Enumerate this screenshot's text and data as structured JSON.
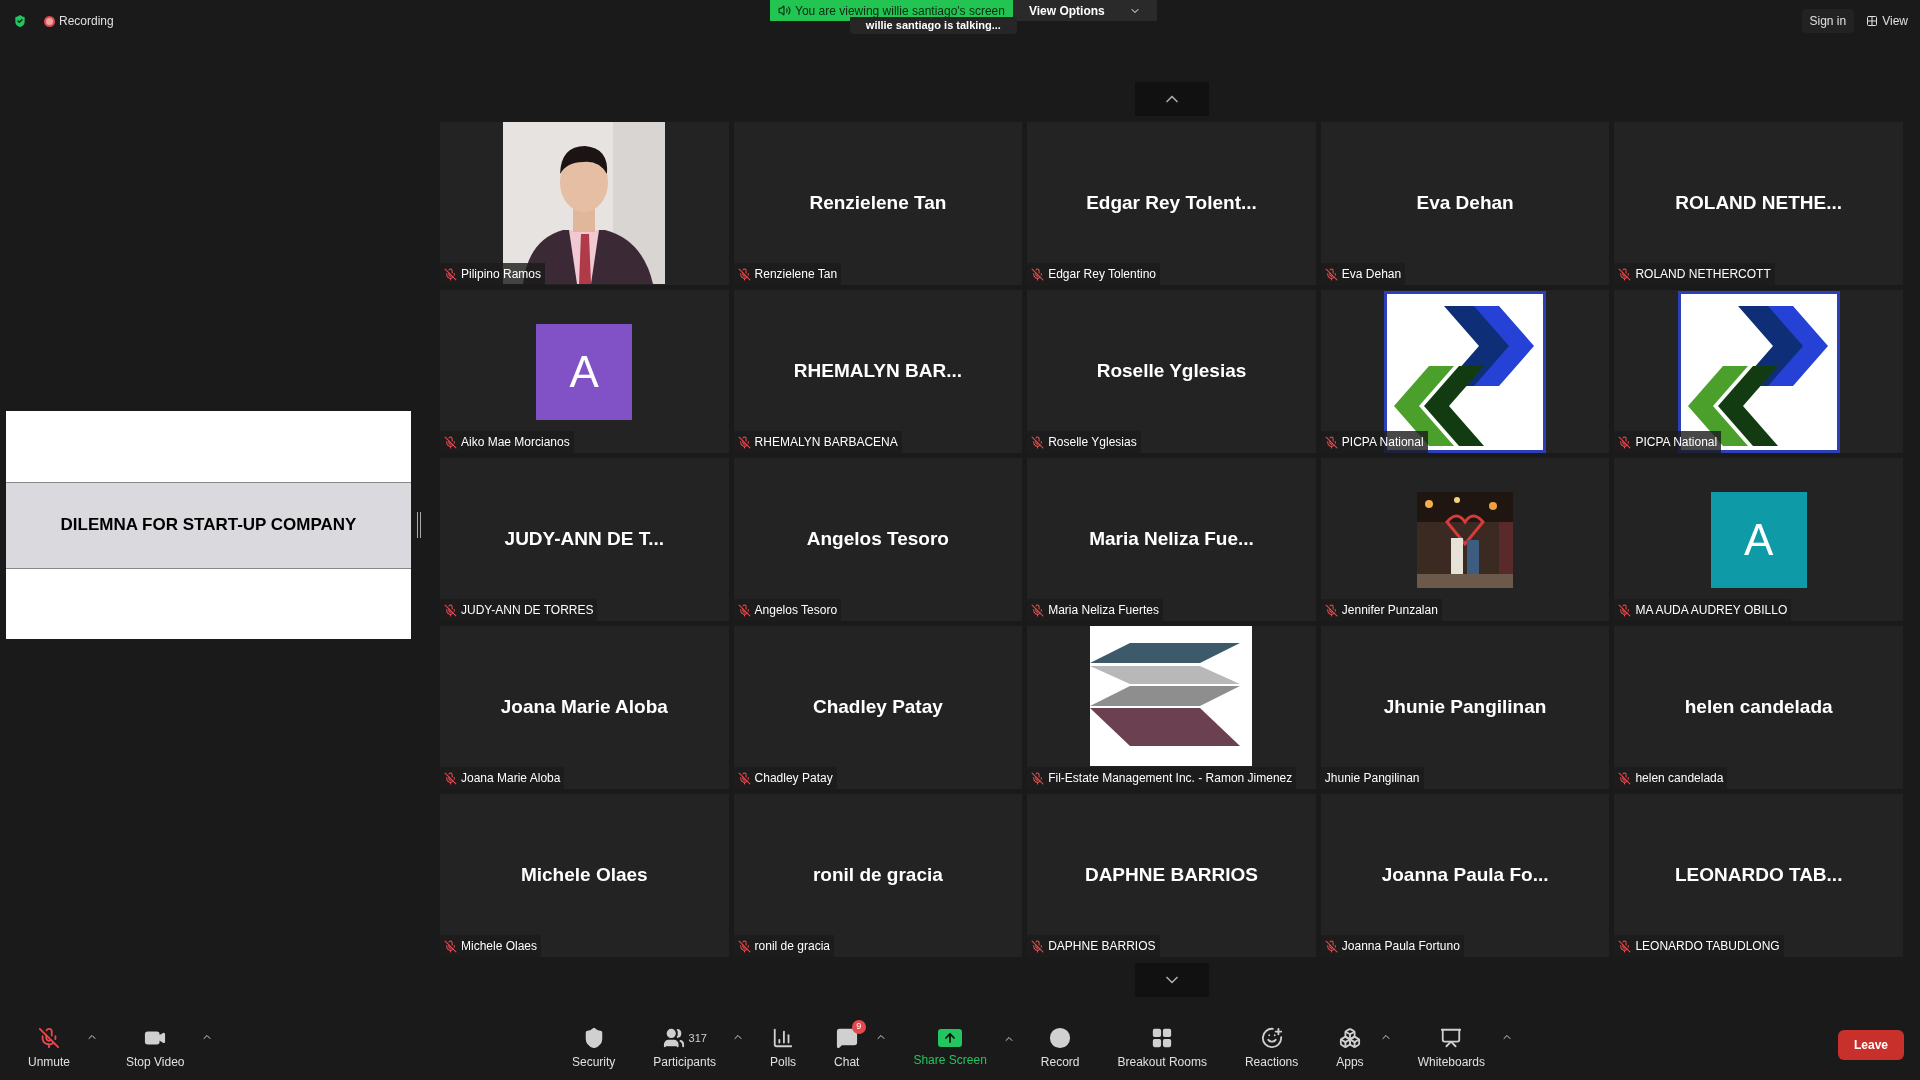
{
  "top_bar": {
    "recording": "Recording",
    "banner": "You are viewing willie santiago's screen",
    "view_options": "View Options",
    "talking": "willie santiago is talking...",
    "sign_in": "Sign in",
    "view": "View"
  },
  "shared_screen": {
    "title": "DILEMNA FOR START-UP COMPANY"
  },
  "tiles": [
    {
      "kind": "picture",
      "name": "Pilipino Ramos",
      "muted": true
    },
    {
      "kind": "name",
      "display": "Renzielene Tan",
      "name": "Renzielene Tan",
      "muted": true
    },
    {
      "kind": "name",
      "display": "Edgar Rey Tolent...",
      "name": "Edgar Rey Tolentino",
      "muted": true
    },
    {
      "kind": "name",
      "display": "Eva Dehan",
      "name": "Eva Dehan",
      "muted": true
    },
    {
      "kind": "name",
      "display": "ROLAND NETHE...",
      "name": "ROLAND NETHERCOTT",
      "muted": true
    },
    {
      "kind": "avatar",
      "letter": "A",
      "color": "#8152c6",
      "name": "Aiko Mae Morcianos",
      "muted": true
    },
    {
      "kind": "name",
      "display": "RHEMALYN BAR...",
      "name": "RHEMALYN BARBACENA",
      "muted": true
    },
    {
      "kind": "name",
      "display": "Roselle Yglesias",
      "name": "Roselle Yglesias",
      "muted": true
    },
    {
      "kind": "chevron-logo",
      "name": "PICPA National",
      "muted": true
    },
    {
      "kind": "chevron-logo",
      "name": "PICPA National",
      "muted": true
    },
    {
      "kind": "name",
      "display": "JUDY-ANN DE T...",
      "name": "JUDY-ANN DE TORRES",
      "muted": true
    },
    {
      "kind": "name",
      "display": "Angelos Tesoro",
      "name": "Angelos Tesoro",
      "muted": true
    },
    {
      "kind": "name",
      "display": "Maria Neliza Fue...",
      "name": "Maria Neliza Fuertes",
      "muted": true
    },
    {
      "kind": "night-picture",
      "name": "Jennifer Punzalan",
      "muted": true
    },
    {
      "kind": "avatar",
      "letter": "A",
      "color": "#0e9aa7",
      "name": "MA AUDA AUDREY OBILLO",
      "muted": true
    },
    {
      "kind": "name",
      "display": "Joana Marie Aloba",
      "name": "Joana Marie Aloba",
      "muted": true
    },
    {
      "kind": "name",
      "display": "Chadley Patay",
      "name": "Chadley Patay",
      "muted": true
    },
    {
      "kind": "stripe-logo",
      "name": "Fil-Estate Management Inc. - Ramon Jimenez",
      "muted": true
    },
    {
      "kind": "name",
      "display": "Jhunie Pangilinan",
      "name": "Jhunie Pangilinan",
      "muted": false
    },
    {
      "kind": "name",
      "display": "helen candelada",
      "name": "helen candelada",
      "muted": true
    },
    {
      "kind": "name",
      "display": "Michele Olaes",
      "name": "Michele Olaes",
      "muted": true
    },
    {
      "kind": "name",
      "display": "ronil de gracia",
      "name": "ronil de gracia",
      "muted": true
    },
    {
      "kind": "name",
      "display": "DAPHNE BARRIOS",
      "name": "DAPHNE BARRIOS",
      "muted": true
    },
    {
      "kind": "name",
      "display": "Joanna Paula Fo...",
      "name": "Joanna Paula Fortuno",
      "muted": true
    },
    {
      "kind": "name",
      "display": "LEONARDO TAB...",
      "name": "LEONARDO TABUDLONG",
      "muted": true
    }
  ],
  "toolbar_left": [
    {
      "kind": "unmute",
      "label": "Unmute",
      "caret": true
    },
    {
      "kind": "video",
      "label": "Stop Video",
      "caret": true
    }
  ],
  "toolbar_center": [
    {
      "kind": "security",
      "label": "Security",
      "caret": false
    },
    {
      "kind": "participants",
      "label": "Participants",
      "count": "317",
      "caret": true
    },
    {
      "kind": "polls",
      "label": "Polls",
      "caret": false
    },
    {
      "kind": "chat",
      "label": "Chat",
      "badge": "9",
      "caret": true
    },
    {
      "kind": "share",
      "label": "Share Screen",
      "caret": true
    },
    {
      "kind": "record",
      "label": "Record",
      "caret": false
    },
    {
      "kind": "rooms",
      "label": "Breakout Rooms",
      "caret": false
    },
    {
      "kind": "reactions",
      "label": "Reactions",
      "caret": false
    },
    {
      "kind": "apps",
      "label": "Apps",
      "caret": true
    },
    {
      "kind": "whiteboards",
      "label": "Whiteboards",
      "caret": true
    }
  ],
  "leave": "Leave"
}
